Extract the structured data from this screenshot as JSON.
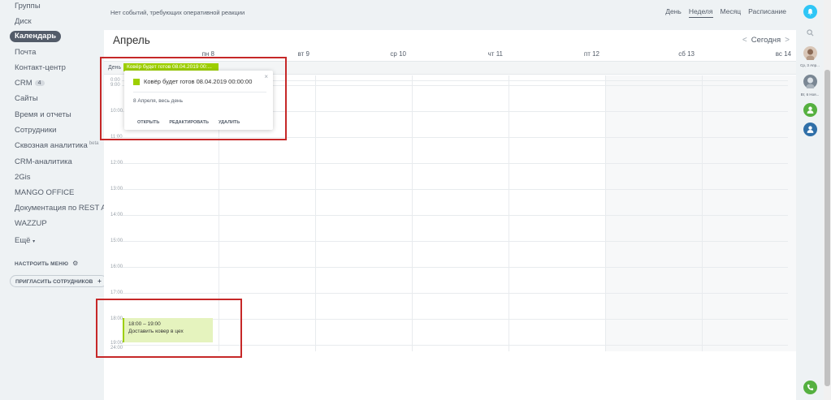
{
  "sidebar": {
    "items": [
      {
        "label": "Группы"
      },
      {
        "label": "Диск"
      },
      {
        "label": "Календарь",
        "active": true
      },
      {
        "label": "Почта"
      },
      {
        "label": "Контакт-центр"
      },
      {
        "label": "CRM",
        "badge": "4"
      },
      {
        "label": "Сайты"
      },
      {
        "label": "Время и отчеты"
      },
      {
        "label": "Сотрудники"
      },
      {
        "label": "Сквозная аналитика",
        "sup": "beta"
      },
      {
        "label": "CRM-аналитика"
      },
      {
        "label": "2Gis"
      },
      {
        "label": "MANGO OFFICE"
      },
      {
        "label": "Документация по REST API"
      },
      {
        "label": "WAZZUP"
      },
      {
        "label": "Ещё",
        "suffix": "▾"
      }
    ],
    "configure_menu": "НАСТРОИТЬ МЕНЮ",
    "invite": "ПРИГЛАСИТЬ СОТРУДНИКОВ"
  },
  "topbar": {
    "note": "Нет событий, требующих оперативной реакции",
    "views": [
      "День",
      "Неделя",
      "Месяц",
      "Расписание"
    ],
    "active_view": "Неделя"
  },
  "calendar": {
    "month": "Апрель",
    "today": "Сегодня",
    "days": [
      "пн 8",
      "вт 9",
      "ср 10",
      "чт 11",
      "пт 12",
      "сб 13",
      "вс 14"
    ],
    "allday_label": "День",
    "allday_event": "Ковёр будет готов 08.04.2019 00:...",
    "hours": [
      "0:00",
      "9:00",
      "10:00",
      "11:00",
      "12:00",
      "13:00",
      "14:00",
      "15:00",
      "16:00",
      "17:00",
      "18:00",
      "19:00",
      "24:00"
    ],
    "timed_event": {
      "time": "18:00 – 19:00",
      "title": "Доставить ковер в цех"
    }
  },
  "popup": {
    "title": "Ковёр будет готов 08.04.2019 00:00:00",
    "date": "8 Апреля, весь день",
    "actions": [
      "ОТКРЫТЬ",
      "РЕДАКТИРОВАТЬ",
      "УДАЛИТЬ"
    ]
  },
  "rail": {
    "user1_caption": "Ср, 3 Апр...",
    "user2_caption": "Вт, 6 Ноя..."
  },
  "colors": {
    "accent_green": "#9dcf00",
    "event_bg": "#e5f3be",
    "highlight_red": "#c62828",
    "bell_blue": "#2fc6f6"
  }
}
